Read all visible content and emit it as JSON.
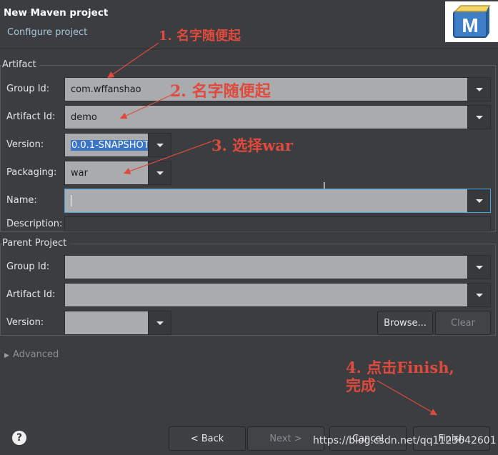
{
  "window": {
    "title": "New Maven project",
    "subtitle": "Configure project"
  },
  "logo": {
    "letter": "M"
  },
  "artifact": {
    "section_title": "Artifact",
    "group_id": {
      "label": "Group Id:",
      "value": "com.wffanshao"
    },
    "artifact_id": {
      "label": "Artifact Id:",
      "value": "demo"
    },
    "version": {
      "label": "Version:",
      "value": "0.0.1-SNAPSHOT"
    },
    "packaging": {
      "label": "Packaging:",
      "value": "war"
    },
    "name": {
      "label": "Name:",
      "value": ""
    },
    "description": {
      "label": "Description:",
      "value": ""
    }
  },
  "parent": {
    "section_title": "Parent Project",
    "group_id": {
      "label": "Group Id:",
      "value": ""
    },
    "artifact_id": {
      "label": "Artifact Id:",
      "value": ""
    },
    "version": {
      "label": "Version:",
      "value": ""
    },
    "browse_label": "Browse...",
    "clear_label": "Clear"
  },
  "advanced": {
    "label": "Advanced"
  },
  "buttons": {
    "back": "< Back",
    "next": "Next >",
    "cancel": "Cancel",
    "finish": "Finish"
  },
  "annotations": {
    "a1": "1. 名字随便起",
    "a2": "2. 名字随便起",
    "a3": "3. 选择war",
    "a4_line1": "4. 点击Finish,",
    "a4_line2": "完成"
  },
  "watermark": "https://blog.csdn.net/qq1123642601",
  "colors": {
    "background": "#3b3d40",
    "field": "#a9abaf",
    "focus": "#4aa3df",
    "annotation": "#e04a3c",
    "selection": "#3b76c6"
  }
}
